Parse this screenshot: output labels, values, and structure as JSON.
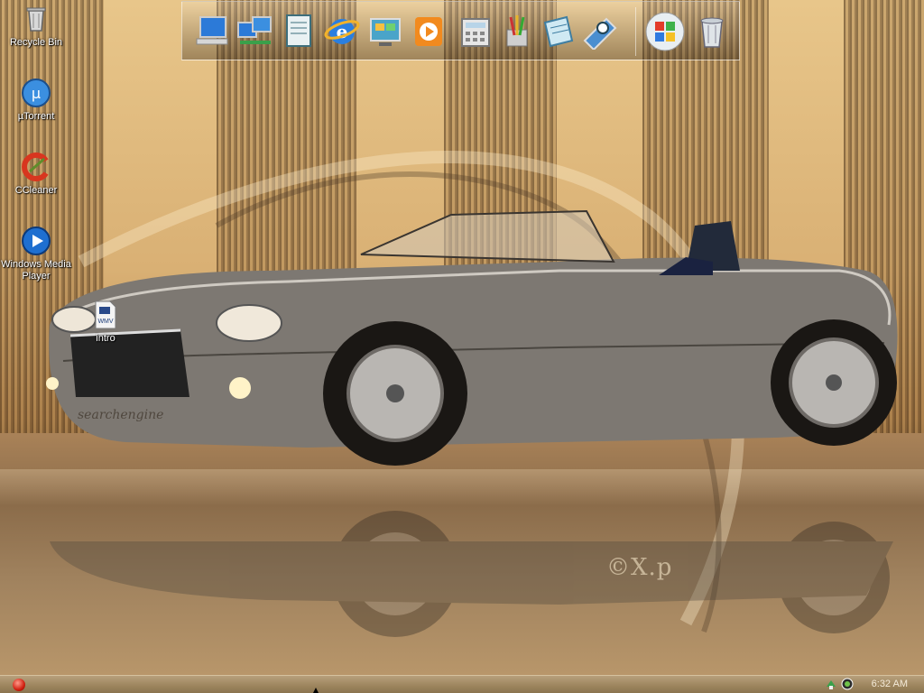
{
  "desktop": {
    "icons": [
      {
        "label": "Recycle Bin",
        "icon": "recycle-bin-icon"
      },
      {
        "label": "µTorrent",
        "icon": "utorrent-icon"
      },
      {
        "label": "CCleaner",
        "icon": "ccleaner-icon"
      },
      {
        "label": "Windows Media Player",
        "icon": "windows-media-player-icon"
      },
      {
        "label": "intro",
        "icon": "wmv-file-icon",
        "badge": "WMV"
      }
    ],
    "wallpaper": {
      "plate_text": "searchengine",
      "watermark": "©X.p"
    }
  },
  "dock": {
    "items": [
      {
        "name": "my-computer",
        "icon": "computer-icon"
      },
      {
        "name": "network",
        "icon": "network-icon"
      },
      {
        "name": "documents",
        "icon": "documents-icon"
      },
      {
        "name": "internet-explorer",
        "icon": "internet-explorer-icon"
      },
      {
        "name": "control-panel",
        "icon": "control-panel-icon"
      },
      {
        "name": "media-player",
        "icon": "media-player-icon"
      },
      {
        "name": "calculator",
        "icon": "calculator-icon"
      },
      {
        "name": "paint",
        "icon": "paint-icon"
      },
      {
        "name": "notepad",
        "icon": "notepad-icon"
      },
      {
        "name": "search",
        "icon": "search-icon"
      },
      {
        "name": "start",
        "icon": "windows-logo-icon"
      },
      {
        "name": "recycle-bin",
        "icon": "trash-icon"
      }
    ]
  },
  "taskbar": {
    "start_icon": "start-orb-icon",
    "tray_icons": [
      "network-tray-icon",
      "utorrent-tray-icon"
    ],
    "clock": "6:32 AM"
  },
  "colors": {
    "accent": "#d01f10",
    "taskbar": "#9e865f"
  }
}
